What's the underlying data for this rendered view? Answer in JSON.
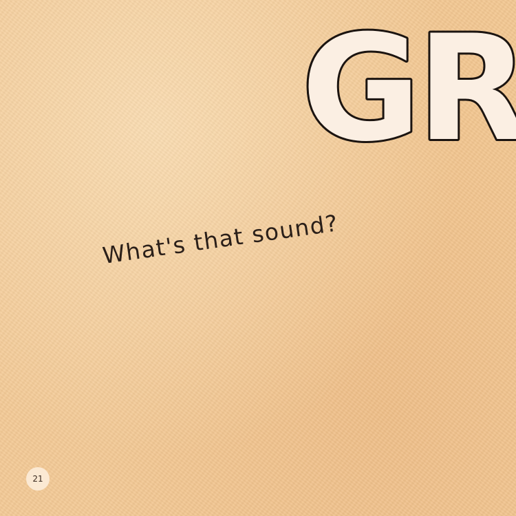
{
  "page": {
    "background_color": "#f3c995",
    "headline": "GRO",
    "question": "What's that sound?",
    "page_number": "21"
  },
  "colors": {
    "letter_fill": "#fbefe3",
    "letter_outline": "#1b1410",
    "text": "#2a1f19"
  }
}
